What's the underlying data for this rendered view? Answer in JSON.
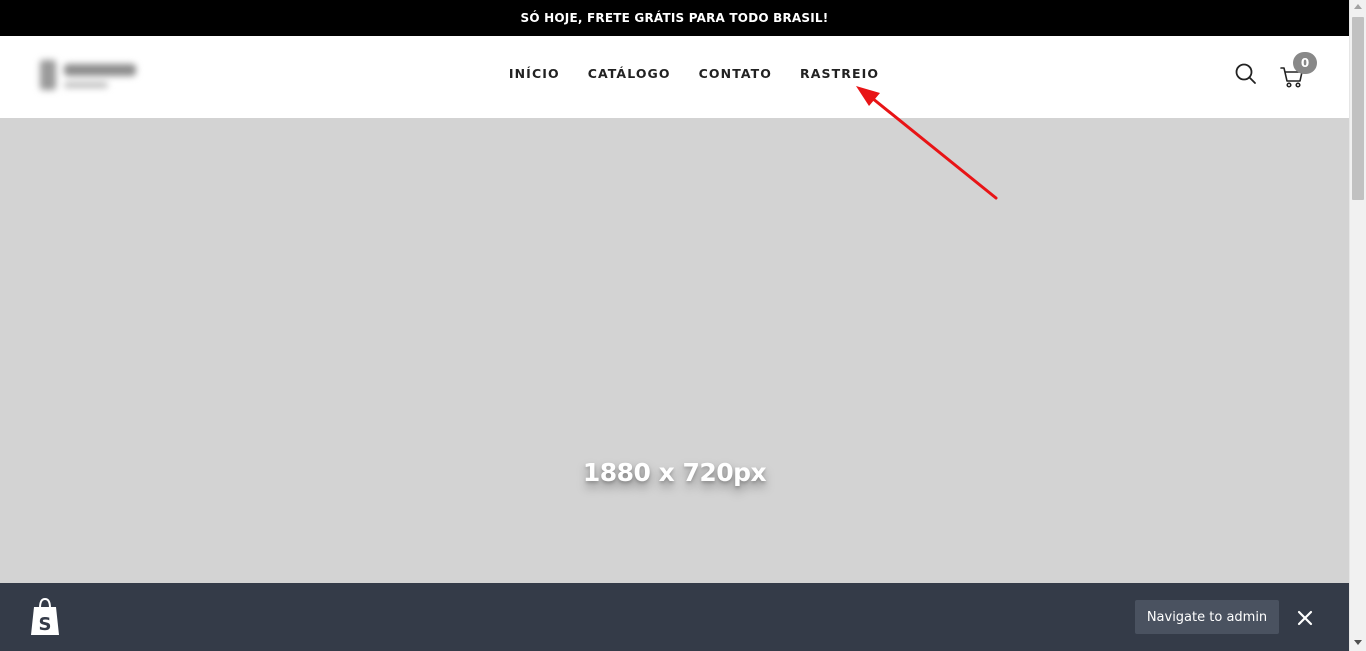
{
  "announcement": {
    "text": "SÓ HOJE, FRETE GRÁTIS PARA TODO BRASIL!"
  },
  "nav": {
    "items": [
      {
        "label": "INÍCIO"
      },
      {
        "label": "CATÁLOGO"
      },
      {
        "label": "CONTATO"
      },
      {
        "label": "RASTREIO"
      }
    ]
  },
  "header": {
    "search_icon": "search-icon",
    "cart_icon": "cart-icon",
    "cart_count": "0"
  },
  "hero": {
    "placeholder_text": "1880 x 720px",
    "background": "#d3d3d3"
  },
  "preview_bar": {
    "navigate_label": "Navigate to admin",
    "logo_icon": "shopify-bag-icon",
    "close_icon": "close-icon"
  },
  "annotation": {
    "arrow_color": "#e81416",
    "points_to": "RASTREIO"
  },
  "colors": {
    "announcement_bg": "#000000",
    "preview_bar_bg": "#343b48",
    "admin_button_bg": "#4a5260",
    "cart_badge_bg": "#888888"
  }
}
